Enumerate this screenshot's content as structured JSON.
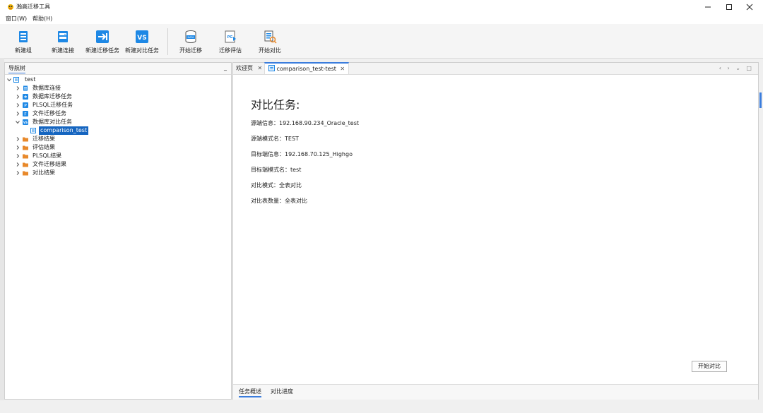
{
  "window": {
    "title": "瀚高迁移工具",
    "controls": [
      "minimize",
      "maximize",
      "close"
    ]
  },
  "menu": [
    {
      "label": "窗口(W)"
    },
    {
      "label": "帮助(H)"
    }
  ],
  "toolbar": {
    "buttons": [
      {
        "label": "新建组",
        "icon": "new-group-icon"
      },
      {
        "label": "新建连接",
        "icon": "new-connection-icon"
      },
      {
        "label": "新建迁移任务",
        "icon": "new-migration-task-icon"
      },
      {
        "label": "新建对比任务",
        "icon": "new-compare-task-icon",
        "icon_text": "VS"
      },
      {
        "label": "开始迁移",
        "icon": "start-migration-icon",
        "icon_text": "DATA"
      },
      {
        "label": "迁移评估",
        "icon": "migration-assessment-icon",
        "icon_text": "PG"
      },
      {
        "label": "开始对比",
        "icon": "start-compare-icon"
      }
    ]
  },
  "nav": {
    "title": "导航树",
    "minimize": "_",
    "root": "test",
    "items": [
      {
        "label": "数据库连接"
      },
      {
        "label": "数据库迁移任务"
      },
      {
        "label": "PLSQL迁移任务"
      },
      {
        "label": "文件迁移任务"
      },
      {
        "label": "数据库对比任务"
      },
      {
        "label": "comparison_test"
      },
      {
        "label": "迁移结果"
      },
      {
        "label": "评估结果"
      },
      {
        "label": "PLSQL结果"
      },
      {
        "label": "文件迁移结果"
      },
      {
        "label": "对比结果"
      }
    ]
  },
  "editor": {
    "tabs": [
      {
        "label": "欢迎页",
        "close": "✕"
      },
      {
        "label": "comparison_test-test",
        "close": "✕"
      }
    ],
    "tab_controls": "‹ › ⌄ □",
    "content": {
      "title": "对比任务:",
      "lines": [
        "源端信息：192.168.90.234_Oracle_test",
        "源端模式名：TEST",
        "目标端信息：192.168.70.125_Highgo",
        "目标端模式名：test",
        "对比模式：全表对比",
        "对比表数量：全表对比"
      ],
      "start_button": "开始对比"
    },
    "bottom_tabs": [
      {
        "label": "任务概述"
      },
      {
        "label": "对比进度"
      }
    ]
  },
  "colors": {
    "accent": "#3b7ddd",
    "selection": "#1565c0",
    "folder": "#e8892b",
    "icon_blue": "#1e88e5"
  }
}
